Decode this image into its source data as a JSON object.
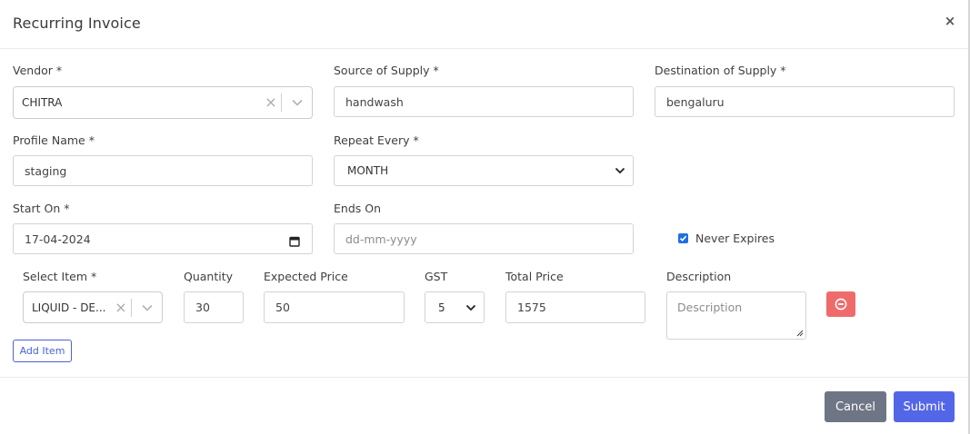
{
  "modal": {
    "title": "Recurring Invoice",
    "close": "×"
  },
  "form": {
    "vendor": {
      "label": "Vendor *",
      "value": "CHITRA"
    },
    "source_of_supply": {
      "label": "Source of Supply *",
      "value": "handwash"
    },
    "destination_of_supply": {
      "label": "Destination of Supply *",
      "value": "bengaluru"
    },
    "profile_name": {
      "label": "Profile Name *",
      "value": "staging"
    },
    "repeat_every": {
      "label": "Repeat Every *",
      "value": "MONTH"
    },
    "start_on": {
      "label": "Start On *",
      "value": "17-04-2024"
    },
    "ends_on": {
      "label": "Ends On",
      "placeholder": "dd-mm-yyyy"
    },
    "never_expires": {
      "label": "Never Expires",
      "checked": true
    }
  },
  "items": {
    "headers": {
      "select_item": "Select Item *",
      "quantity": "Quantity",
      "expected_price": "Expected Price",
      "gst": "GST",
      "total_price": "Total Price",
      "description": "Description"
    },
    "rows": [
      {
        "item": "LIQUID - DE...",
        "quantity": "30",
        "expected_price": "50",
        "gst": "5",
        "total_price": "1575",
        "description_placeholder": "Description"
      }
    ],
    "add_item_label": "Add Item"
  },
  "footer": {
    "cancel_label": "Cancel",
    "submit_label": "Submit"
  },
  "colors": {
    "primary": "#5466e8",
    "secondary": "#6e7585",
    "danger": "#ef6b6b",
    "checkbox": "#1f6fe5"
  },
  "icons": {
    "close": "close-icon",
    "clear": "clear-icon",
    "chevron": "chevron-down-icon",
    "calendar": "calendar-icon",
    "remove": "remove-circle-icon",
    "check": "check-icon"
  }
}
